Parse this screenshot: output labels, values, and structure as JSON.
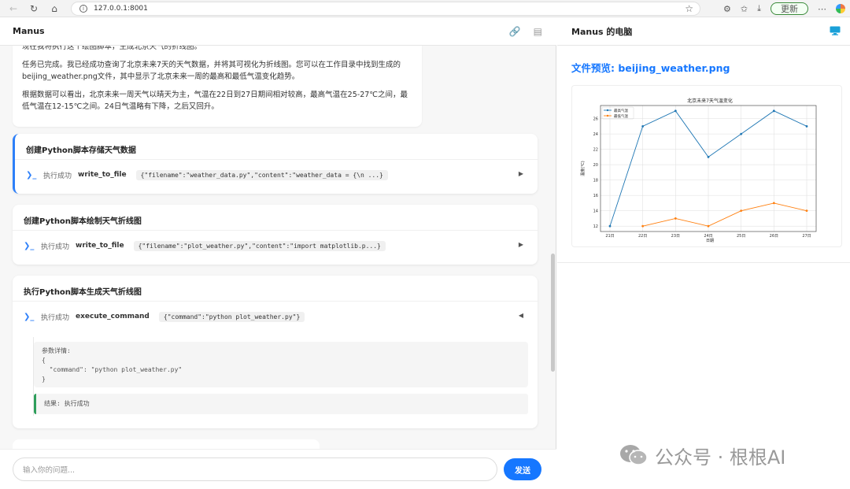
{
  "browser": {
    "url": "127.0.0.1:8001",
    "update_label": "更新"
  },
  "left_panel": {
    "header_title": "Manus",
    "messages": [
      "现在我将执行这个绘图脚本，生成北京天气的折线图。",
      "任务已完成。我已经成功查询了北京未来7天的天气数据，并将其可视化为折线图。您可以在工作目录中找到生成的beijing_weather.png文件，其中显示了北京未来一周的最高和最低气温变化趋势。",
      "根据数据可以看出，北京未来一周天气以晴天为主，气温在22日到27日期间相对较高，最高气温在25-27℃之间，最低气温在12-15℃之间。24日气温略有下降，之后又回升。"
    ],
    "steps": [
      {
        "title": "创建Python脚本存储天气数据",
        "status": "执行成功",
        "tool": "write_to_file",
        "args": "{\"filename\":\"weather_data.py\",\"content\":\"weather_data = {\\n ...}",
        "toggle": "▶"
      },
      {
        "title": "创建Python脚本绘制天气折线图",
        "status": "执行成功",
        "tool": "write_to_file",
        "args": "{\"filename\":\"plot_weather.py\",\"content\":\"import matplotlib.p...}",
        "toggle": "▶"
      },
      {
        "title": "执行Python脚本生成天气折线图",
        "status": "执行成功",
        "tool": "execute_command",
        "args": "{\"command\":\"python plot_weather.py\"}",
        "toggle": "◀",
        "params_label": "参数详情:",
        "params_lines": [
          "{",
          "  \"command\": \"python plot_weather.py\"",
          "}"
        ],
        "result": "结果: 执行成功"
      }
    ],
    "input_placeholder": "输入你的问题...",
    "send_label": "发送"
  },
  "right_panel": {
    "header_title": "Manus 的电脑",
    "preview_title": "文件预览: beijing_weather.png"
  },
  "chart_data": {
    "type": "line",
    "title": "北京未来7天气温变化",
    "xlabel": "日期",
    "ylabel": "温度(℃)",
    "categories": [
      "21日",
      "22日",
      "23日",
      "24日",
      "25日",
      "26日",
      "27日"
    ],
    "series": [
      {
        "name": "最高气温",
        "color": "#1f77b4",
        "values": [
          12,
          25,
          27,
          21,
          24,
          27,
          25
        ]
      },
      {
        "name": "最低气温",
        "color": "#ff7f0e",
        "values": [
          null,
          12,
          13,
          12,
          14,
          15,
          14
        ]
      }
    ],
    "yticks": [
      12,
      14,
      16,
      18,
      20,
      22,
      24,
      26
    ],
    "ylim": [
      11.3,
      27.7
    ],
    "grid": true,
    "legend": "top-left"
  },
  "watermark": {
    "text": "公众号 · 根根AI"
  },
  "colors": {
    "accent": "#1677ff",
    "success": "#2e9e5b"
  }
}
